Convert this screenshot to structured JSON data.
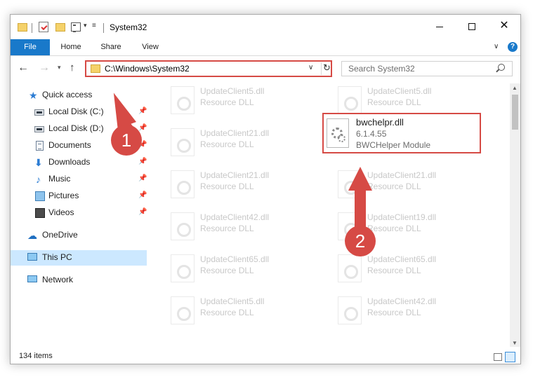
{
  "window": {
    "title": "System32",
    "quick_access_toolbar": {
      "dropdown_glyph": "▾",
      "more_glyph": "≡"
    },
    "controls": {
      "close_glyph": "✕"
    }
  },
  "ribbon": {
    "tabs": [
      "File",
      "Home",
      "Share",
      "View"
    ],
    "expand_glyph": "∨",
    "help_glyph": "?"
  },
  "navigation": {
    "back_glyph": "←",
    "forward_glyph": "→",
    "recent_glyph": "▾",
    "up_glyph": "↑"
  },
  "address_bar": {
    "path": "C:\\Windows\\System32",
    "dropdown_glyph": "∨",
    "refresh_glyph": "↻"
  },
  "search": {
    "placeholder": "Search System32"
  },
  "sidebar": {
    "pin_glyph": "📌",
    "items": [
      {
        "label": "Quick access",
        "icon": "star-icon",
        "glyph": "★",
        "pinned": false
      },
      {
        "label": "Local Disk (C:)",
        "icon": "drive-icon",
        "pinned": true
      },
      {
        "label": "Local Disk (D:)",
        "icon": "drive-icon",
        "pinned": true
      },
      {
        "label": "Documents",
        "icon": "documents-icon",
        "pinned": true
      },
      {
        "label": "Downloads",
        "icon": "download-icon",
        "glyph": "⬇",
        "pinned": true
      },
      {
        "label": "Music",
        "icon": "music-icon",
        "glyph": "♪",
        "pinned": true
      },
      {
        "label": "Pictures",
        "icon": "pictures-icon",
        "pinned": true
      },
      {
        "label": "Videos",
        "icon": "videos-icon",
        "pinned": true
      },
      {
        "label": "OneDrive",
        "icon": "cloud-icon",
        "glyph": "☁",
        "pinned": false
      },
      {
        "label": "This PC",
        "icon": "computer-icon",
        "pinned": false,
        "selected": true
      },
      {
        "label": "Network",
        "icon": "network-icon",
        "pinned": false
      }
    ]
  },
  "files": {
    "column_left": [
      {
        "name": "UpdateClient5.dll",
        "desc": "Resource DLL"
      },
      {
        "name": "UpdateClient21.dll",
        "desc": "Resource DLL"
      },
      {
        "name": "UpdateClient21.dll",
        "desc": "Resource DLL"
      },
      {
        "name": "UpdateClient42.dll",
        "desc": "Resource DLL"
      },
      {
        "name": "UpdateClient65.dll",
        "desc": "Resource DLL"
      },
      {
        "name": "UpdateClient5.dll",
        "desc": "Resource DLL"
      }
    ],
    "column_right": [
      {
        "name": "UpdateClient5.dll",
        "desc": "Resource DLL"
      },
      {
        "name": "UpdateClient21.dll",
        "desc": "Resource DLL"
      },
      {
        "name": "UpdateClient19.dll",
        "desc": "Resource DLL"
      },
      {
        "name": "UpdateClient65.dll",
        "desc": "Resource DLL"
      },
      {
        "name": "UpdateClient42.dll",
        "desc": "Resource DLL"
      }
    ],
    "highlighted": {
      "name": "bwchelpr.dll",
      "version": "6.1.4.55",
      "description": "BWCHelper Module"
    }
  },
  "scrollbar": {
    "up_glyph": "▲",
    "down_glyph": "▼"
  },
  "status_bar": {
    "item_count": "134 items"
  },
  "annotations": {
    "step1": "1",
    "step2": "2",
    "accent_color": "#d64a45"
  }
}
